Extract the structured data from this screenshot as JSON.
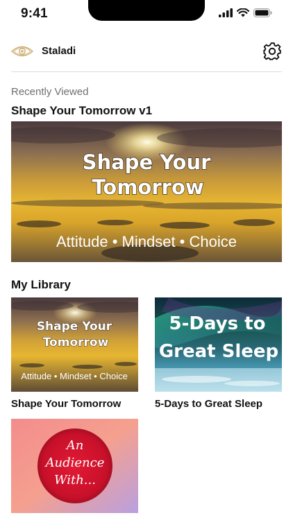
{
  "status_bar": {
    "time": "9:41"
  },
  "header": {
    "logo_icon": "eye-logo-icon",
    "app_name": "Staladi",
    "settings_icon": "gear-icon"
  },
  "recently_viewed": {
    "caption": "Recently Viewed",
    "title": "Shape Your Tomorrow v1",
    "thumbnail": {
      "line1": "Shape Your",
      "line2": "Tomorrow",
      "tagline": "Attitude • Mindset • Choice"
    }
  },
  "library": {
    "title": "My Library",
    "items": [
      {
        "label": "Shape Your Tomorrow",
        "thumb_line1": "Shape Your",
        "thumb_line2": "Tomorrow",
        "thumb_tagline": "Attitude • Mindset • Choice"
      },
      {
        "label": "5-Days to Great Sleep",
        "thumb_line1": "5-Days to",
        "thumb_line2": "Great Sleep"
      },
      {
        "label": "",
        "thumb_line1": "An",
        "thumb_line2": "Audience",
        "thumb_line3": "With..."
      }
    ]
  },
  "colors": {
    "text_primary": "#111111",
    "text_secondary": "#6f6f6f",
    "divider": "#dcdcdc",
    "sunset_gold": "#e2b52c",
    "aurora_green": "#3bd6a6",
    "audience_red": "#d2122e"
  }
}
